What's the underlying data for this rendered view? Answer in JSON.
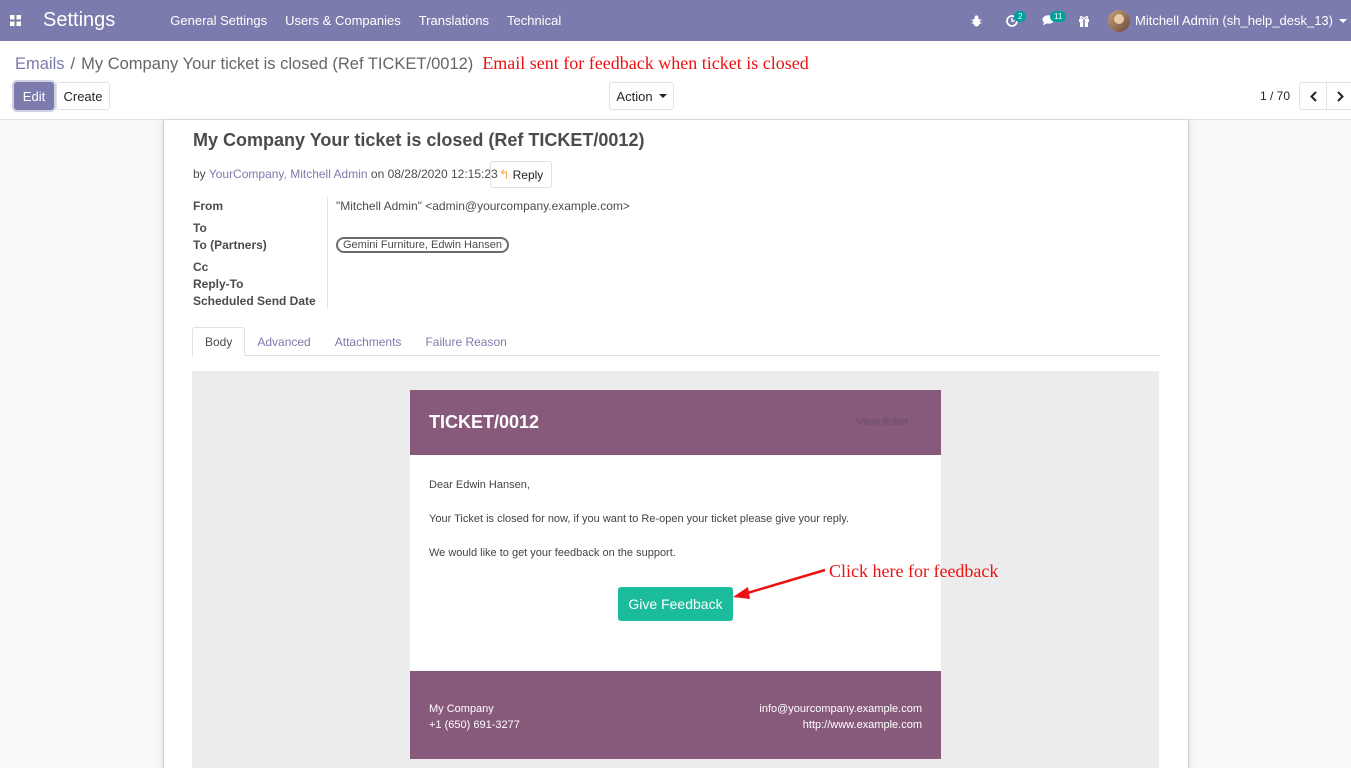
{
  "navbar": {
    "app_name": "Settings",
    "menu": [
      "General Settings",
      "Users & Companies",
      "Translations",
      "Technical"
    ],
    "activity_count": "2",
    "messages_count": "11",
    "user_name": "Mitchell Admin (sh_help_desk_13)",
    "icons": [
      "apps-grid-icon",
      "bug-icon",
      "clock-icon",
      "chat-icon",
      "gift-icon",
      "caret-down-icon"
    ]
  },
  "breadcrumb": {
    "parent": "Emails",
    "separator": "/",
    "current": "My Company Your ticket is closed (Ref TICKET/0012)"
  },
  "annotations": {
    "title_note": "Email sent for feedback when ticket is closed",
    "feedback_note": "Click here for feedback"
  },
  "toolbar": {
    "edit": "Edit",
    "create": "Create",
    "action": "Action",
    "pager": "1 / 70"
  },
  "mail": {
    "subject": "My Company Your ticket is closed (Ref TICKET/0012)",
    "by_prefix": "by",
    "author": "YourCompany, Mitchell Admin",
    "on_date": "on 08/28/2020 12:15:23",
    "reply": "Reply",
    "fields": {
      "from_label": "From",
      "from_value": "\"Mitchell Admin\" <admin@yourcompany.example.com>",
      "to_label": "To",
      "to_partners_label": "To (Partners)",
      "to_partners_value": "Gemini Furniture, Edwin Hansen",
      "cc_label": "Cc",
      "reply_to_label": "Reply-To",
      "scheduled_label": "Scheduled Send Date"
    },
    "tabs": [
      "Body",
      "Advanced",
      "Attachments",
      "Failure Reason"
    ]
  },
  "email_body": {
    "ticket": "TICKET/0012",
    "view_link": "View ticket",
    "greeting": "Dear Edwin Hansen,",
    "line1": "Your Ticket is closed for now, if you want to Re-open your ticket please give your reply.",
    "line2": "We would like to get your feedback on the support.",
    "button": "Give Feedback",
    "company": "My Company",
    "phone": "+1 (650) 691-3277",
    "email": "info@yourcompany.example.com",
    "website": "http://www.example.com"
  },
  "colors": {
    "navbar": "#7c7bad",
    "email_header": "#875a7b",
    "feedback_button": "#1abc9c",
    "annotation": "#ee1111"
  }
}
